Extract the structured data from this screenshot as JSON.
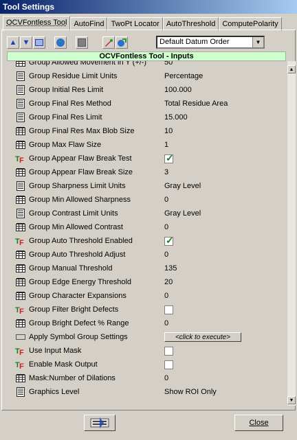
{
  "window": {
    "title": "Tool Settings"
  },
  "tabs": [
    {
      "label": "OCVFontless Tool"
    },
    {
      "label": "AutoFind"
    },
    {
      "label": "TwoPt Locator"
    },
    {
      "label": "AutoThreshold"
    },
    {
      "label": "ComputePolarity"
    }
  ],
  "toolbar": {
    "datum_select": "Default Datum Order"
  },
  "section": {
    "title": "OCVFontless Tool - Inputs"
  },
  "rows": [
    {
      "label": "Group Allowed Movement in Y (+/-)",
      "value": "50",
      "icon": "grid-icon",
      "type": "text"
    },
    {
      "label": "Group Residue Limit Units",
      "value": "Percentage",
      "icon": "list-icon",
      "type": "text"
    },
    {
      "label": "Group Initial Res Limit",
      "value": "100.000",
      "icon": "list-icon",
      "type": "text"
    },
    {
      "label": "Group Final Res Method",
      "value": "Total Residue Area",
      "icon": "list-icon",
      "type": "text"
    },
    {
      "label": "Group Final Res Limit",
      "value": "15.000",
      "icon": "list-icon",
      "type": "text"
    },
    {
      "label": "Group Final Res Max Blob Size",
      "value": "10",
      "icon": "grid-icon",
      "type": "text"
    },
    {
      "label": "Group Max Flaw Size",
      "value": "1",
      "icon": "grid-icon",
      "type": "text"
    },
    {
      "label": "Group Appear Flaw Break Test",
      "value": "",
      "icon": "tf-icon",
      "type": "check",
      "checked": true
    },
    {
      "label": "Group Appear Flaw Break Size",
      "value": "3",
      "icon": "grid-icon",
      "type": "text"
    },
    {
      "label": "Group Sharpness Limit Units",
      "value": "Gray Level",
      "icon": "list-icon",
      "type": "text"
    },
    {
      "label": "Group Min Allowed Sharpness",
      "value": "0",
      "icon": "grid-icon",
      "type": "text"
    },
    {
      "label": "Group Contrast Limit Units",
      "value": "Gray Level",
      "icon": "list-icon",
      "type": "text"
    },
    {
      "label": "Group Min Allowed Contrast",
      "value": "0",
      "icon": "grid-icon",
      "type": "text"
    },
    {
      "label": "Group Auto Threshold Enabled",
      "value": "",
      "icon": "tf-icon",
      "type": "check",
      "checked": true
    },
    {
      "label": "Group Auto Threshold Adjust",
      "value": "0",
      "icon": "grid-icon",
      "type": "text"
    },
    {
      "label": "Group Manual Threshold",
      "value": "135",
      "icon": "grid-icon",
      "type": "text"
    },
    {
      "label": "Group Edge Energy Threshold",
      "value": "20",
      "icon": "grid-icon",
      "type": "text"
    },
    {
      "label": "Group Character Expansions",
      "value": "0",
      "icon": "grid-icon",
      "type": "text"
    },
    {
      "label": "Group Filter Bright Defects",
      "value": "",
      "icon": "tf-icon",
      "type": "check",
      "checked": false
    },
    {
      "label": "Group Bright Defect % Range",
      "value": "0",
      "icon": "grid-icon",
      "type": "text"
    },
    {
      "label": "Apply Symbol Group Settings",
      "value": "<click to execute>",
      "icon": "button-icon",
      "type": "button"
    },
    {
      "label": "Use Input Mask",
      "value": "",
      "icon": "tf-icon",
      "type": "check",
      "checked": false
    },
    {
      "label": "Enable Mask Output",
      "value": "",
      "icon": "tf-icon",
      "type": "check",
      "checked": false
    },
    {
      "label": "Mask:Number of Dilations",
      "value": "0",
      "icon": "grid-icon",
      "type": "text"
    },
    {
      "label": "Graphics Level",
      "value": "Show ROI Only",
      "icon": "list-icon",
      "type": "text"
    }
  ],
  "footer": {
    "close_label": "Close"
  }
}
